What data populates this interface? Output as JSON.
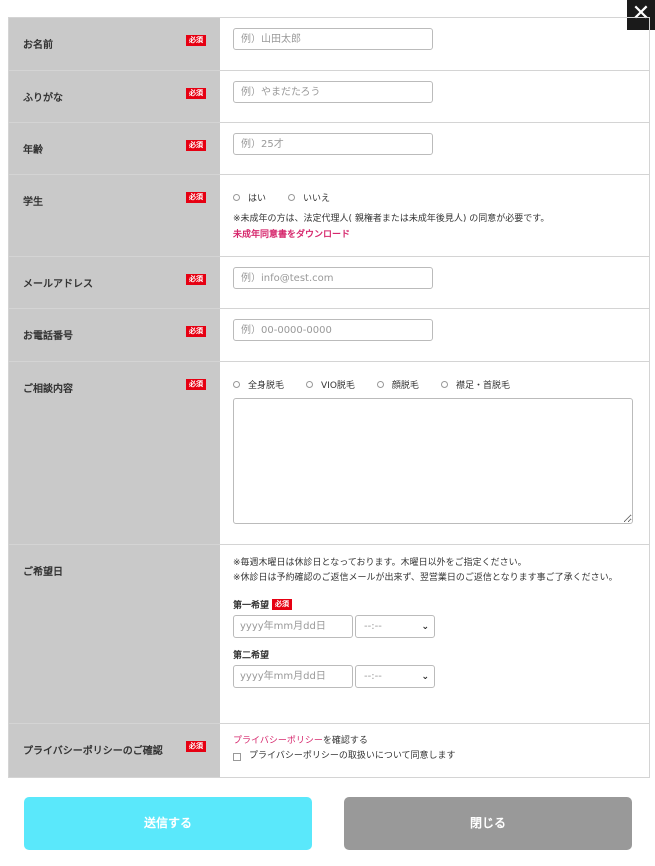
{
  "close_icon_glyph": "✕",
  "required_badge": "必須",
  "fields": {
    "name": {
      "label": "お名前",
      "placeholder": "例）山田太郎"
    },
    "kana": {
      "label": "ふりがな",
      "placeholder": "例）やまだたろう"
    },
    "age": {
      "label": "年齢",
      "placeholder": "例）25才"
    },
    "student": {
      "label": "学生",
      "options": [
        "はい",
        "いいえ"
      ],
      "note": "※未成年の方は、法定代理人( 親権者または未成年後見人) の同意が必要です。",
      "link": "未成年同意書をダウンロード"
    },
    "email": {
      "label": "メールアドレス",
      "placeholder": "例）info@test.com"
    },
    "phone": {
      "label": "お電話番号",
      "placeholder": "例）00-0000-0000"
    },
    "consult": {
      "label": "ご相談内容",
      "options": [
        "全身脱毛",
        "VIO脱毛",
        "顔脱毛",
        "襟足・首脱毛"
      ]
    },
    "preferred_date": {
      "label": "ご希望日",
      "note1": "※毎週木曜日は休診日となっております。木曜日以外をご指定ください。",
      "note2": "※休診日は予約確認のご返信メールが出来ず、翌営業日のご返信となります事ご了承ください。",
      "first_label": "第一希望",
      "second_label": "第二希望",
      "date_placeholder": "yyyy年mm月dd日",
      "time_placeholder": "--:--"
    },
    "privacy": {
      "label": "プライバシーポリシーのご確認",
      "link": "プライバシーポリシー",
      "link_suffix": "を確認する",
      "checkbox_label": "プライバシーポリシーの取扱いについて同意します"
    }
  },
  "buttons": {
    "send": "送信する",
    "close": "閉じる"
  },
  "colors": {
    "required": "#e60012",
    "link": "#d6286d",
    "send": "#5ae8fb",
    "close": "#999999"
  }
}
